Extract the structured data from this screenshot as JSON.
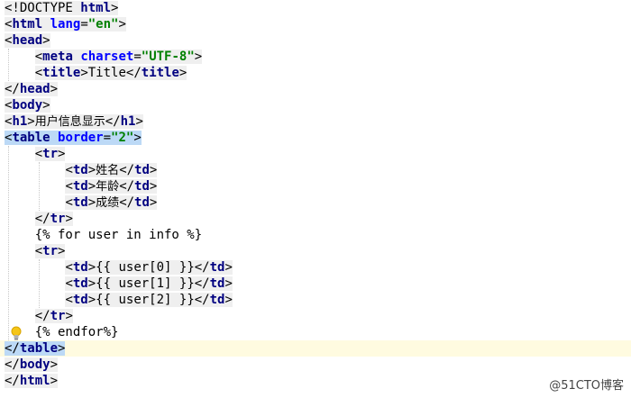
{
  "editor": {
    "lines": [
      {
        "indent": "",
        "parts": [
          [
            "p",
            "<!DOCTYPE "
          ],
          [
            "tn",
            "html"
          ],
          [
            "p",
            ">"
          ]
        ]
      },
      {
        "indent": "",
        "parts": [
          [
            "p",
            "<"
          ],
          [
            "tn",
            "html"
          ],
          [
            "p",
            " "
          ],
          [
            "an",
            "lang"
          ],
          [
            "p",
            "="
          ],
          [
            "av",
            "\"en\""
          ],
          [
            "p",
            ">"
          ]
        ]
      },
      {
        "indent": "",
        "parts": [
          [
            "p",
            "<"
          ],
          [
            "tn",
            "head"
          ],
          [
            "p",
            ">"
          ]
        ]
      },
      {
        "indent": "    ",
        "parts": [
          [
            "p",
            "<"
          ],
          [
            "tn",
            "meta"
          ],
          [
            "p",
            " "
          ],
          [
            "an",
            "charset"
          ],
          [
            "p",
            "="
          ],
          [
            "av",
            "\"UTF-8\""
          ],
          [
            "p",
            ">"
          ]
        ]
      },
      {
        "indent": "    ",
        "parts": [
          [
            "p",
            "<"
          ],
          [
            "tn",
            "title"
          ],
          [
            "p",
            ">"
          ],
          [
            "tx",
            "Title"
          ],
          [
            "p",
            "</"
          ],
          [
            "tn",
            "title"
          ],
          [
            "p",
            ">"
          ]
        ]
      },
      {
        "indent": "",
        "parts": [
          [
            "p",
            "</"
          ],
          [
            "tn",
            "head"
          ],
          [
            "p",
            ">"
          ]
        ]
      },
      {
        "indent": "",
        "parts": [
          [
            "p",
            "<"
          ],
          [
            "tn",
            "body"
          ],
          [
            "p",
            ">"
          ]
        ]
      },
      {
        "indent": "",
        "parts": [
          [
            "p",
            "<"
          ],
          [
            "tn",
            "h1"
          ],
          [
            "p",
            ">"
          ],
          [
            "tx",
            "用户信息显示"
          ],
          [
            "p",
            "</"
          ],
          [
            "tn",
            "h1"
          ],
          [
            "p",
            ">"
          ]
        ]
      },
      {
        "indent": "",
        "highlight": "open",
        "parts": [
          [
            "p",
            "<"
          ],
          [
            "tn",
            "table"
          ],
          [
            "p",
            " "
          ],
          [
            "an",
            "border"
          ],
          [
            "p",
            "="
          ],
          [
            "av",
            "\"2\""
          ],
          [
            "p",
            ">"
          ]
        ]
      },
      {
        "indent": "    ",
        "parts": [
          [
            "p",
            "<"
          ],
          [
            "tn",
            "tr"
          ],
          [
            "p",
            ">"
          ]
        ]
      },
      {
        "indent": "        ",
        "parts": [
          [
            "p",
            "<"
          ],
          [
            "tn",
            "td"
          ],
          [
            "p",
            ">"
          ],
          [
            "tx",
            "姓名"
          ],
          [
            "p",
            "</"
          ],
          [
            "tn",
            "td"
          ],
          [
            "p",
            ">"
          ]
        ]
      },
      {
        "indent": "        ",
        "parts": [
          [
            "p",
            "<"
          ],
          [
            "tn",
            "td"
          ],
          [
            "p",
            ">"
          ],
          [
            "tx",
            "年龄"
          ],
          [
            "p",
            "</"
          ],
          [
            "tn",
            "td"
          ],
          [
            "p",
            ">"
          ]
        ]
      },
      {
        "indent": "        ",
        "parts": [
          [
            "p",
            "<"
          ],
          [
            "tn",
            "td"
          ],
          [
            "p",
            ">"
          ],
          [
            "tx",
            "成绩"
          ],
          [
            "p",
            "</"
          ],
          [
            "tn",
            "td"
          ],
          [
            "p",
            ">"
          ]
        ]
      },
      {
        "indent": "    ",
        "parts": [
          [
            "p",
            "</"
          ],
          [
            "tn",
            "tr"
          ],
          [
            "p",
            ">"
          ]
        ]
      },
      {
        "indent": "    ",
        "plain": true,
        "parts": [
          [
            "tx",
            "{% for user in info %}"
          ]
        ]
      },
      {
        "indent": "    ",
        "parts": [
          [
            "p",
            "<"
          ],
          [
            "tn",
            "tr"
          ],
          [
            "p",
            ">"
          ]
        ]
      },
      {
        "indent": "        ",
        "parts": [
          [
            "p",
            "<"
          ],
          [
            "tn",
            "td"
          ],
          [
            "p",
            ">"
          ],
          [
            "tx",
            "{{ user[0] }}"
          ],
          [
            "p",
            "</"
          ],
          [
            "tn",
            "td"
          ],
          [
            "p",
            ">"
          ]
        ]
      },
      {
        "indent": "        ",
        "parts": [
          [
            "p",
            "<"
          ],
          [
            "tn",
            "td"
          ],
          [
            "p",
            ">"
          ],
          [
            "tx",
            "{{ user[1] }}"
          ],
          [
            "p",
            "</"
          ],
          [
            "tn",
            "td"
          ],
          [
            "p",
            ">"
          ]
        ]
      },
      {
        "indent": "        ",
        "parts": [
          [
            "p",
            "<"
          ],
          [
            "tn",
            "td"
          ],
          [
            "p",
            ">"
          ],
          [
            "tx",
            "{{ user[2] }}"
          ],
          [
            "p",
            "</"
          ],
          [
            "tn",
            "td"
          ],
          [
            "p",
            ">"
          ]
        ]
      },
      {
        "indent": "    ",
        "parts": [
          [
            "p",
            "</"
          ],
          [
            "tn",
            "tr"
          ],
          [
            "p",
            ">"
          ]
        ]
      },
      {
        "indent": "    ",
        "plain": true,
        "parts": [
          [
            "tx",
            "{% endfor%}"
          ]
        ]
      },
      {
        "indent": "",
        "highlight": "close",
        "caret": true,
        "parts": [
          [
            "p",
            "</"
          ],
          [
            "tn",
            "table"
          ],
          [
            "p",
            ">"
          ]
        ]
      },
      {
        "indent": "",
        "parts": [
          [
            "p",
            "</"
          ],
          [
            "tn",
            "body"
          ],
          [
            "p",
            ">"
          ]
        ]
      },
      {
        "indent": "",
        "parts": [
          [
            "p",
            "</"
          ],
          [
            "tn",
            "html"
          ],
          [
            "p",
            ">"
          ]
        ]
      }
    ]
  },
  "gutter": {
    "icon": "lightbulb-icon"
  },
  "watermark": {
    "text": "@51CTO博客"
  },
  "colors": {
    "tag_name": "#000080",
    "attr_name": "#0000ff",
    "attr_value": "#008000",
    "tag_background": "#efefef",
    "match_highlight": "#bcd9f6",
    "caret_line": "#fffbe0"
  }
}
